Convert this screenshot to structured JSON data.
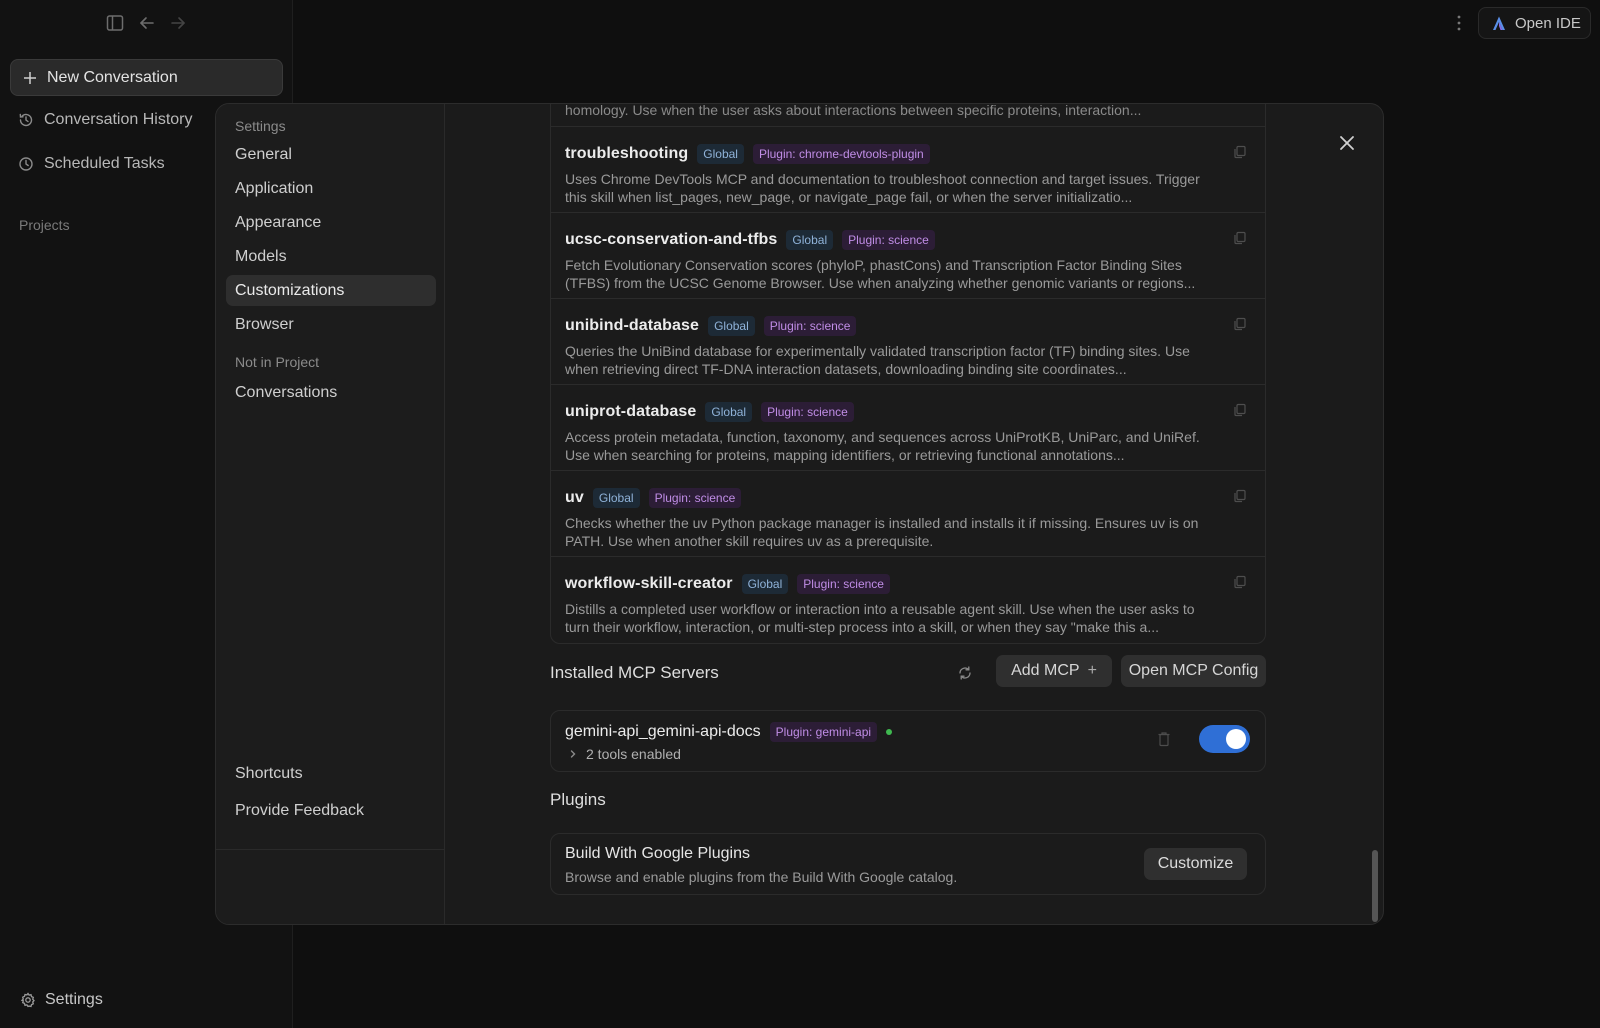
{
  "app_sidebar": {
    "new_conversation": "New Conversation",
    "conversation_history": "Conversation History",
    "scheduled_tasks": "Scheduled Tasks",
    "projects_label": "Projects",
    "settings": "Settings"
  },
  "header": {
    "open_ide": "Open IDE"
  },
  "settings_nav": {
    "section_title": "Settings",
    "items": [
      "General",
      "Application",
      "Appearance",
      "Models",
      "Customizations",
      "Browser"
    ],
    "active_item": "Customizations",
    "not_in_project_label": "Not in Project",
    "conversations": "Conversations",
    "shortcuts": "Shortcuts",
    "provide_feedback": "Provide Feedback"
  },
  "skills": {
    "partial_desc": "homology. Use when the user asks about interactions between specific proteins, interaction...",
    "items": [
      {
        "name": "troubleshooting",
        "scope": "Global",
        "plugin": "Plugin: chrome-devtools-plugin",
        "desc": "Uses Chrome DevTools MCP and documentation to troubleshoot connection and target issues. Trigger this skill when list_pages, new_page, or navigate_page fail, or when the server initializatio..."
      },
      {
        "name": "ucsc-conservation-and-tfbs",
        "scope": "Global",
        "plugin": "Plugin: science",
        "desc": "Fetch Evolutionary Conservation scores (phyloP, phastCons) and Transcription Factor Binding Sites (TFBS) from the UCSC Genome Browser. Use when analyzing whether genomic variants or regions..."
      },
      {
        "name": "unibind-database",
        "scope": "Global",
        "plugin": "Plugin: science",
        "desc": "Queries the UniBind database for experimentally validated transcription factor (TF) binding sites. Use when retrieving direct TF-DNA interaction datasets, downloading binding site coordinates..."
      },
      {
        "name": "uniprot-database",
        "scope": "Global",
        "plugin": "Plugin: science",
        "desc": "Access protein metadata, function, taxonomy, and sequences across UniProtKB, UniParc, and UniRef. Use when searching for proteins, mapping identifiers, or retrieving functional annotations..."
      },
      {
        "name": "uv",
        "scope": "Global",
        "plugin": "Plugin: science",
        "desc": "Checks whether the uv Python package manager is installed and installs it if missing. Ensures uv is on PATH. Use when another skill requires uv as a prerequisite."
      },
      {
        "name": "workflow-skill-creator",
        "scope": "Global",
        "plugin": "Plugin: science",
        "desc": "Distills a completed user workflow or interaction into a reusable agent skill. Use when the user asks to turn their workflow, interaction, or multi-step process into a skill, or when they say \"make this a..."
      }
    ]
  },
  "mcp": {
    "title": "Installed MCP Servers",
    "add_label": "Add MCP",
    "add_icon": "+",
    "open_config_label": "Open MCP Config",
    "server": {
      "name": "gemini-api_gemini-api-docs",
      "plugin": "Plugin: gemini-api",
      "status_color": "#3fb950",
      "tools": "2 tools enabled",
      "enabled": true
    }
  },
  "plugins": {
    "title": "Plugins",
    "card_title": "Build With Google Plugins",
    "card_desc": "Browse and enable plugins from the Build With Google catalog.",
    "customize_label": "Customize"
  },
  "colors": {
    "toggle_on": "#2f6fd6",
    "global_badge": "#8fb2d8",
    "plugin_badge": "#c08de6"
  }
}
